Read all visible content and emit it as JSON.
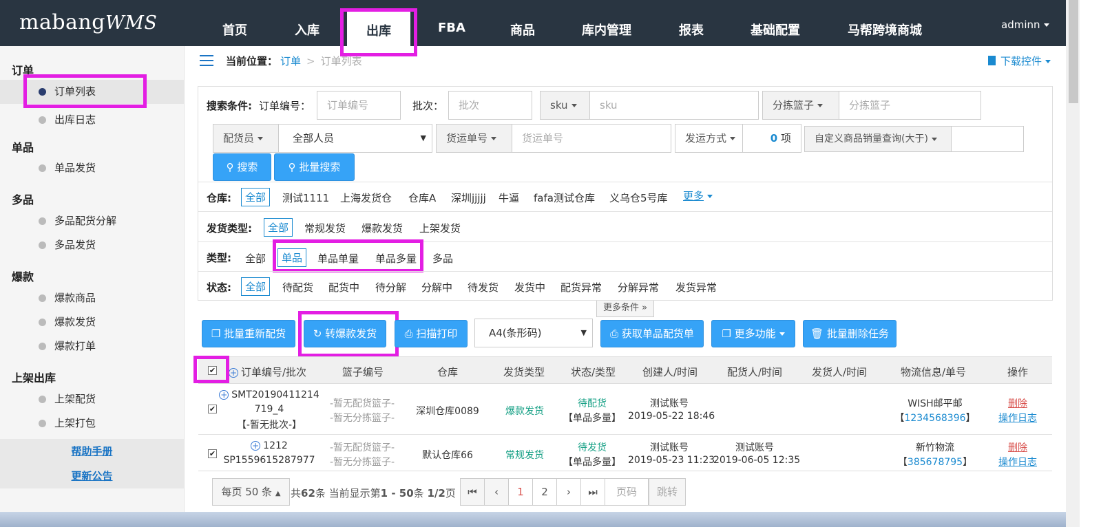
{
  "topbar": {
    "logo_main": "mabang",
    "logo_sub": "WMS",
    "nav": [
      "首页",
      "入库",
      "出库",
      "FBA",
      "商品",
      "库内管理",
      "报表",
      "基础配置",
      "马帮跨境商城"
    ],
    "user": "adminn"
  },
  "sidebar": {
    "groups": [
      "订单",
      "单品",
      "多品",
      "爆款",
      "上架出库"
    ],
    "items": [
      "订单列表",
      "出库日志",
      "单品发货",
      "多品配货分解",
      "多品发货",
      "爆款商品",
      "爆款发货",
      "爆款打单",
      "上架配货",
      "上架打包"
    ],
    "help": "帮助手册",
    "update": "更新公告"
  },
  "breadcrumb": {
    "label": "当前位置：",
    "link": "订单",
    "sep": ">",
    "current": "订单列表"
  },
  "download": "下载控件",
  "search": {
    "title": "搜索条件:",
    "order_label": "订单编号：",
    "order_ph": "订单编号",
    "batch_label": "批次：",
    "batch_ph": "批次",
    "sku_btn": "sku",
    "sku_ph": "sku",
    "basket_btn": "分拣篮子",
    "basket_ph": "分拣篮子",
    "picker_btn": "配货员",
    "picker_value": "全部人员",
    "ship_btn": "货运单号",
    "ship_ph": "货运单号",
    "method_btn": "发运方式",
    "method_count": "0",
    "method_unit": "项",
    "custom_btn": "自定义商品销量查询(大于)",
    "search_btn": "搜索",
    "batch_search_btn": "批量搜索"
  },
  "filters": {
    "warehouse_label": "仓库:",
    "warehouses": [
      "全部",
      "测试1111",
      "上海发货仓",
      "仓库A",
      "深圳jjjjj",
      "牛逼",
      "fafa测试仓库",
      "义乌仓5号库"
    ],
    "warehouse_more": "更多",
    "ship_type_label": "发货类型:",
    "ship_types": [
      "全部",
      "常规发货",
      "爆款发货",
      "上架发货"
    ],
    "type_label": "类型:",
    "types": [
      "全部",
      "单品",
      "单品单量",
      "单品多量",
      "多品"
    ],
    "status_label": "状态:",
    "statuses": [
      "全部",
      "待配货",
      "配货中",
      "待分解",
      "分解中",
      "待发货",
      "发货中",
      "配货异常",
      "分解异常",
      "发货异常"
    ],
    "more_conditions": "更多条件"
  },
  "actions": {
    "rebatch": "批量重新配货",
    "to_hot": "转爆款发货",
    "scan_print": "扫描打印",
    "paper": "A4(条形码)",
    "get_single": "获取单品配货单",
    "more": "更多功能",
    "batch_delete": "批量删除任务"
  },
  "table": {
    "headers": [
      "订单编号/批次",
      "篮子编号",
      "仓库",
      "发货类型",
      "状态/类型",
      "创建人/时间",
      "配货人/时间",
      "发货人/时间",
      "物流信息/单号",
      "操作"
    ],
    "rows": [
      {
        "order1": "SMT20190411214",
        "order2": "719_4",
        "batch": "【-暂无批次-】",
        "basket1": "-暂无配货篮子-",
        "basket2": "-暂无分拣篮子-",
        "warehouse": "深圳仓库0089",
        "ship_type": "爆款发货",
        "status": "待配货",
        "kind": "【单品多量】",
        "creator": "测试账号",
        "created": "2019-05-22 18:46",
        "picker": "",
        "picked": "",
        "logistics": "WISH邮平邮",
        "tracking": "1234568396",
        "delete": "删除",
        "log": "操作日志"
      },
      {
        "order1": "1212",
        "order2": "SP1559615287977",
        "batch": "",
        "basket1": "-暂无配货篮子-",
        "basket2": "-暂无分拣篮子-",
        "warehouse": "默认仓库66",
        "ship_type": "常规发货",
        "status": "待发货",
        "kind": "【单品多量】",
        "creator": "测试账号",
        "created": "2019-05-23 11:23",
        "picker": "测试账号",
        "picked": "2019-06-05 12:35",
        "logistics": "新竹物流",
        "tracking": "385678795",
        "delete": "删除",
        "log": "操作日志"
      }
    ]
  },
  "pager": {
    "per_page": "每页 50 条",
    "summary_a": "共",
    "total": "62",
    "summary_b": "条 当前显示第",
    "range": "1 - 50",
    "summary_c": "条",
    "pages": "1/2",
    "summary_d": "页",
    "p1": "1",
    "p2": "2",
    "page_ph": "页码",
    "jump": "跳转"
  }
}
